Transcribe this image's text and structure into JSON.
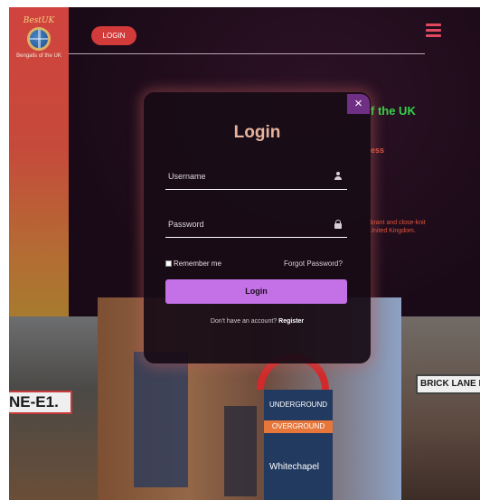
{
  "brand": {
    "logo_title": "BestUK",
    "logo_subtitle": "Bengalis of the UK"
  },
  "header": {
    "login_label": "LOGIN"
  },
  "hero": {
    "title_fragment": "f the UK",
    "subtitle_fragment": "ess",
    "text_line1": "ibrant and close-knit",
    "text_line2": "United Kingdom."
  },
  "photos": {
    "left_sign": "NE-E1.",
    "right_sign": "BRICK LANE E",
    "ug_top": "UNDERGROUND",
    "ug_mid": "OVERGROUND",
    "ug_station": "Whitechapel"
  },
  "modal": {
    "close_glyph": "×",
    "title": "Login",
    "username_placeholder": "Username",
    "password_placeholder": "Password",
    "remember_label": "Remember me",
    "forgot_label": "Forgot Password?",
    "submit_label": "Login",
    "register_prompt": "Don't have an account?",
    "register_link": "Register"
  },
  "colors": {
    "accent": "#c471e8",
    "login_pill": "#d33a3a",
    "hero_green": "#33d54a"
  }
}
